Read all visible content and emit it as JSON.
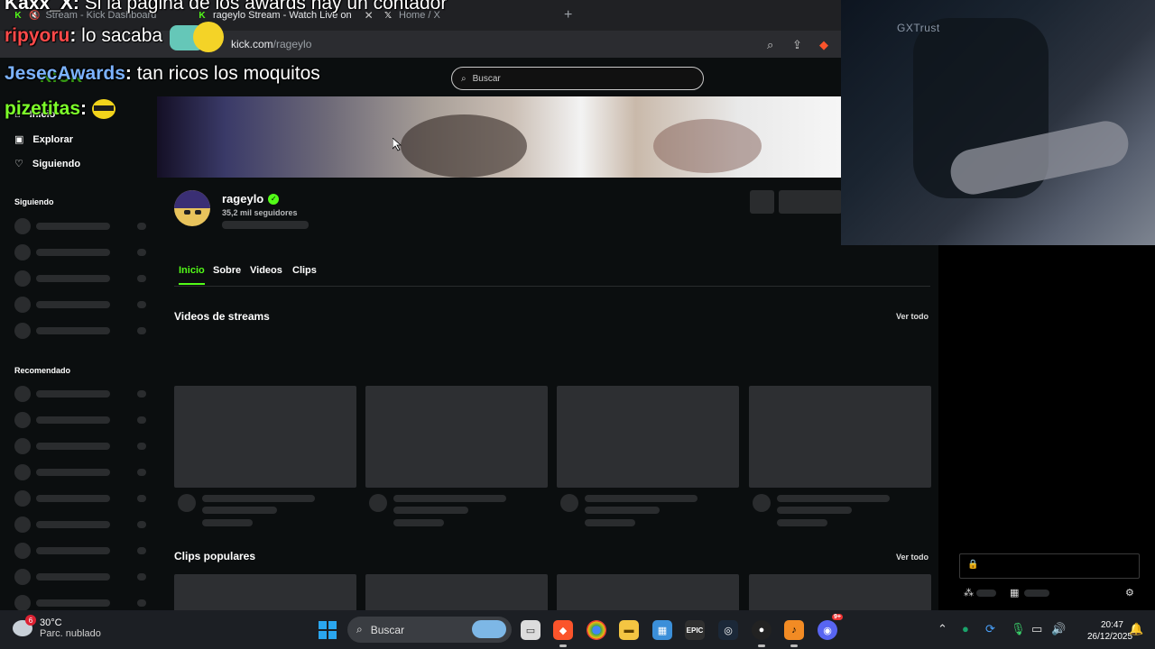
{
  "browser": {
    "tabs": [
      {
        "label": "Stream - Kick Dashboard",
        "icon": "kick-icon"
      },
      {
        "label": "rageylo Stream - Watch Live on",
        "icon": "kick-icon",
        "close": "✕"
      },
      {
        "label": "Home / X",
        "icon": "x-icon"
      }
    ],
    "new_tab": "+",
    "url_host": "kick.com",
    "url_path": "/rageylo"
  },
  "kick": {
    "search_placeholder": "Buscar",
    "nav": [
      {
        "label": "Inicio",
        "icon": "home-icon"
      },
      {
        "label": "Explorar",
        "icon": "explore-icon"
      },
      {
        "label": "Siguiendo",
        "icon": "heart-icon"
      }
    ],
    "section_following": "Siguiendo",
    "section_recommended": "Recomendado",
    "channel": {
      "name": "rageylo",
      "verified_glyph": "✓",
      "followers": "35,2 mil seguidores"
    },
    "profile_tabs": [
      {
        "label": "Inicio",
        "active": true
      },
      {
        "label": "Sobre",
        "active": false
      },
      {
        "label": "Videos",
        "active": false
      },
      {
        "label": "Clips",
        "active": false
      }
    ],
    "sections": [
      {
        "title": "Videos de streams",
        "see_all": "Ver todo"
      },
      {
        "title": "Clips populares",
        "see_all": "Ver todo"
      }
    ],
    "accent_color": "#53fc18"
  },
  "webcam": {
    "brand_text": "GXTrust"
  },
  "chat_overlay": [
    {
      "user": "Kaxx_X",
      "message": "Si la pagina de los awards hay un contador",
      "color": "#ffffff"
    },
    {
      "user": "ripyoru",
      "message": "lo sacaba",
      "color": "#ff4a4a"
    },
    {
      "user": "JesecAwards",
      "message": "tan ricos los moquitos",
      "color": "#7cb3ff"
    },
    {
      "user": "pizetitas",
      "message": "",
      "color": "#7dff2a"
    }
  ],
  "taskbar": {
    "temperature": "30°C",
    "condition": "Parc. nublado",
    "weather_badge": "6",
    "search_label": "Buscar",
    "time": "20:47",
    "date": "26/12/2025",
    "discord_badge": "9+"
  }
}
